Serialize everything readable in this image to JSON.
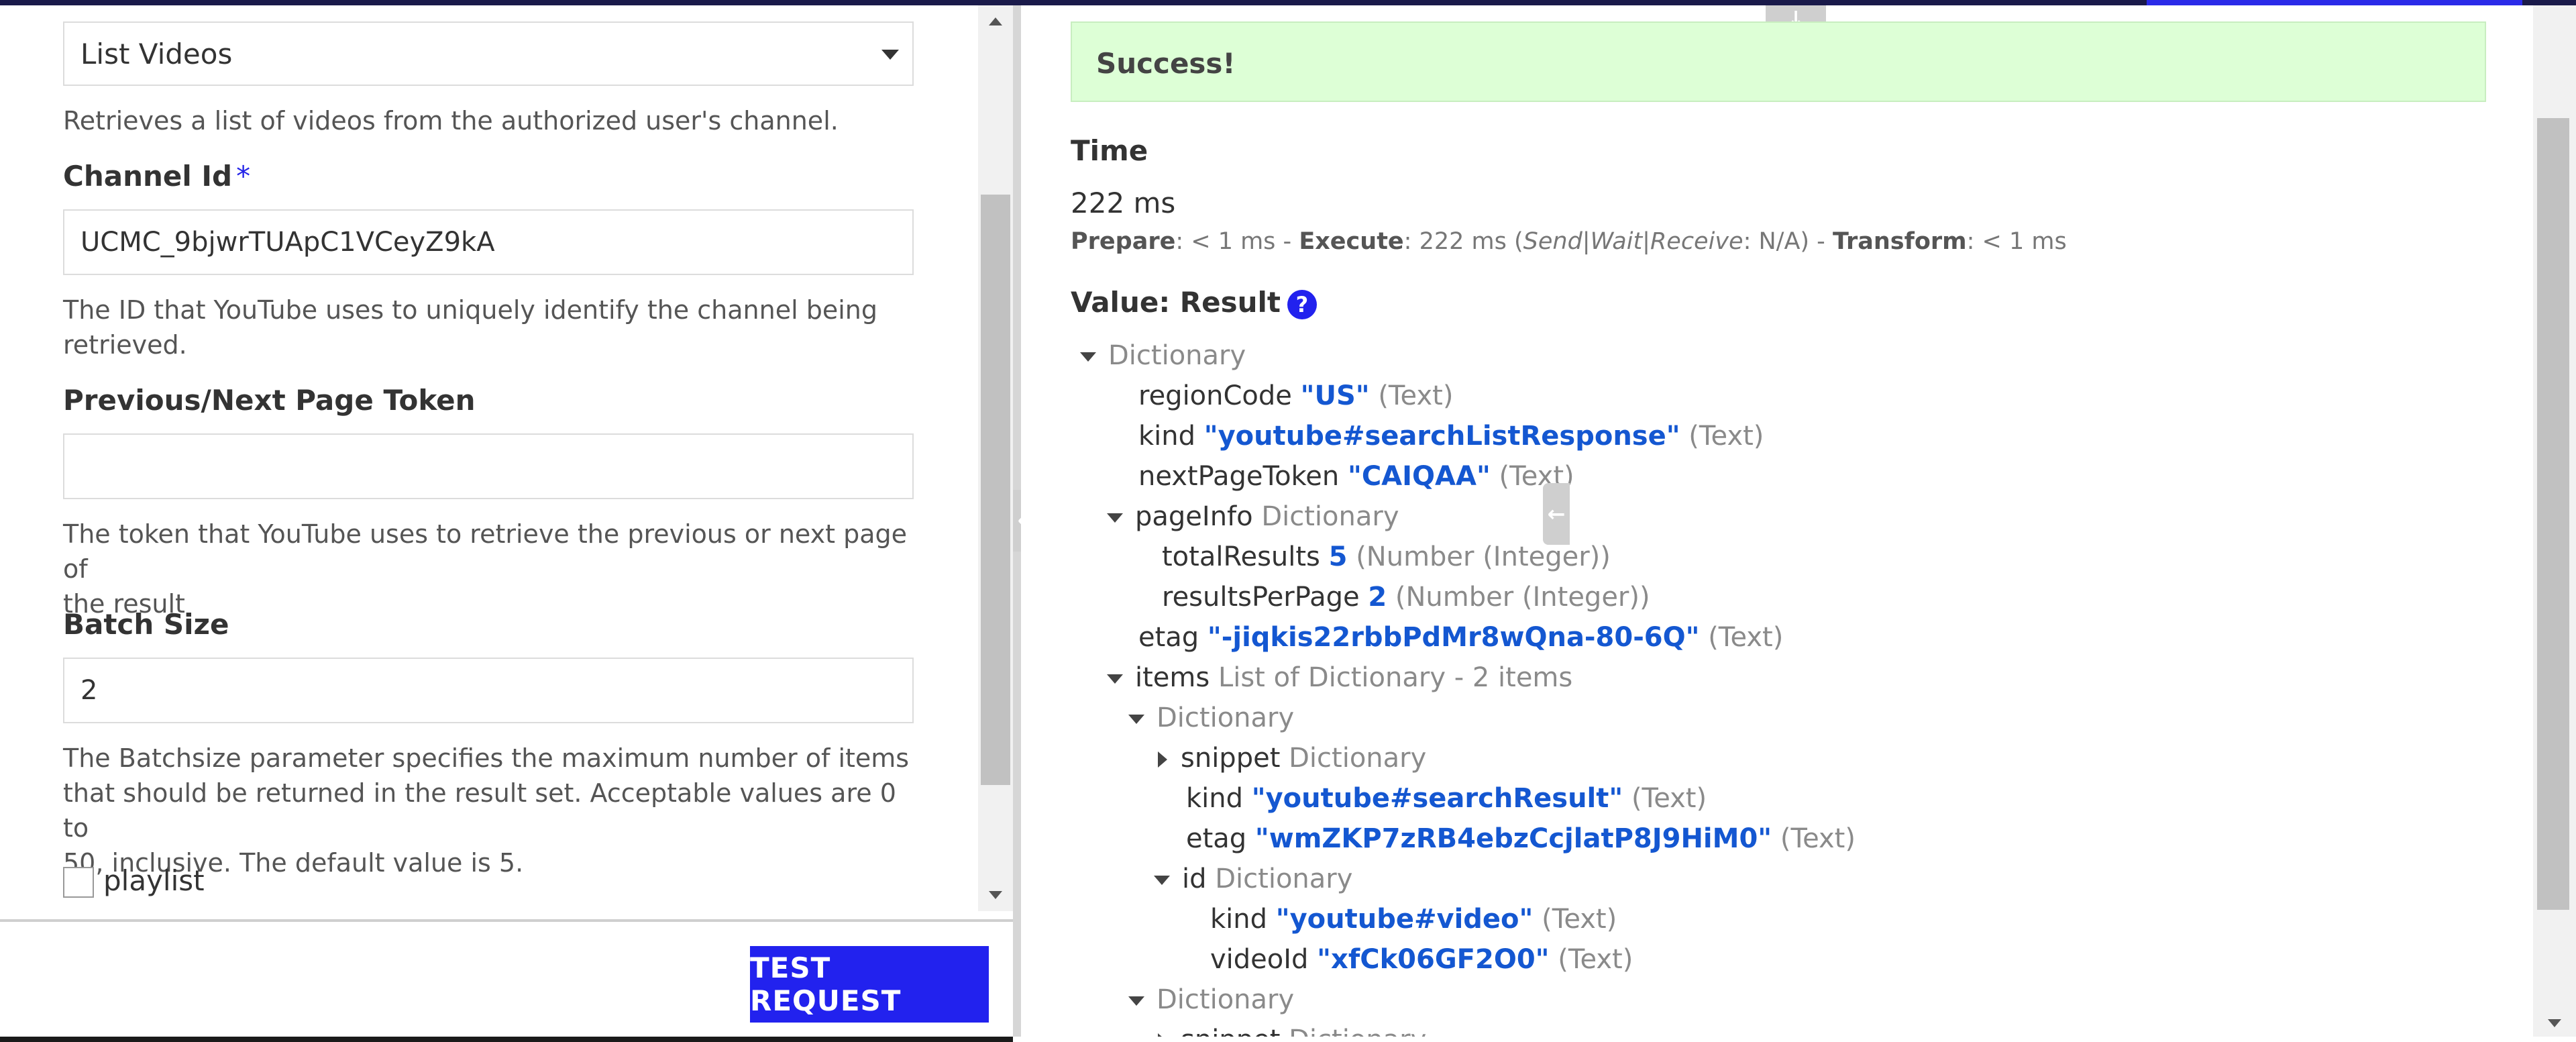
{
  "left": {
    "operation": {
      "selected": "List Videos",
      "description": "Retrieves a list of videos from the authorized user's channel."
    },
    "channel_id": {
      "label": "Channel Id",
      "required_mark": "*",
      "value": "UCMC_9bjwrTUApC1VCeyZ9kA",
      "help_line1": "The ID that YouTube uses to uniquely identify the channel being",
      "help_line2": "retrieved."
    },
    "page_token": {
      "label": "Previous/Next Page Token",
      "value": "",
      "help_line1": "The token that YouTube uses to retrieve the previous or next page of",
      "help_line2": "the result"
    },
    "batch_size": {
      "label": "Batch Size",
      "value": "2",
      "help_line1": "The Batchsize parameter specifies the maximum number of items",
      "help_line2": "that should be returned in the result set. Acceptable values are 0 to",
      "help_line3": "50, inclusive. The default value is 5."
    },
    "playlist": {
      "label": "playlist",
      "checked": false
    },
    "test_button": "TEST REQUEST"
  },
  "right": {
    "status": "Success!",
    "time_label": "Time",
    "time_value": "222 ms",
    "timing": {
      "prepare_label": "Prepare",
      "prepare_value": ": < 1 ms - ",
      "execute_label": "Execute",
      "execute_value": ": 222 ms (",
      "swr": "Send|Wait|Receive",
      "swr_value": ": N/A) - ",
      "transform_label": "Transform",
      "transform_value": ": < 1 ms"
    },
    "value_label": "Value: Result",
    "help_icon": "?",
    "tree": {
      "root": "Dictionary",
      "regionCode": {
        "key": "regionCode",
        "value": "\"US\"",
        "type": "(Text)"
      },
      "kind": {
        "key": "kind",
        "value": "\"youtube#searchListResponse\"",
        "type": "(Text)"
      },
      "nextPageToken": {
        "key": "nextPageToken",
        "value": "\"CAIQAA\"",
        "type": "(Text)"
      },
      "pageInfo": {
        "key": "pageInfo",
        "type": "Dictionary"
      },
      "totalResults": {
        "key": "totalResults",
        "value": "5",
        "type": "(Number (Integer))"
      },
      "resultsPerPage": {
        "key": "resultsPerPage",
        "value": "2",
        "type": "(Number (Integer))"
      },
      "etag": {
        "key": "etag",
        "value": "\"-jiqkis22rbbPdMr8wQna-80-6Q\"",
        "type": "(Text)"
      },
      "items": {
        "key": "items",
        "type": "List of Dictionary - 2 items"
      },
      "item1": "Dictionary",
      "snippet": {
        "key": "snippet",
        "type": "Dictionary"
      },
      "item1_kind": {
        "key": "kind",
        "value": "\"youtube#searchResult\"",
        "type": "(Text)"
      },
      "item1_etag": {
        "key": "etag",
        "value": "\"wmZKP7zRB4ebzCcjlatP8J9HiM0\"",
        "type": "(Text)"
      },
      "id": {
        "key": "id",
        "type": "Dictionary"
      },
      "id_kind": {
        "key": "kind",
        "value": "\"youtube#video\"",
        "type": "(Text)"
      },
      "videoId": {
        "key": "videoId",
        "value": "\"xfCk06GF2O0\"",
        "type": "(Text)"
      },
      "item2": "Dictionary",
      "item2_snippet": {
        "key": "snippet",
        "type": "Dictionary"
      }
    }
  },
  "colors": {
    "accent": "#2222ee",
    "success_bg": "#ddffd6",
    "value_blue": "#1457d1"
  },
  "icons": {
    "collapse_left": "arrow-left-icon",
    "collapse_right": "arrow-left-icon",
    "down_handle": "arrow-down-icon"
  }
}
